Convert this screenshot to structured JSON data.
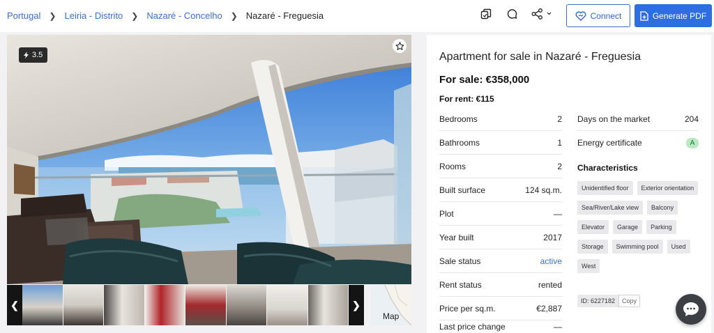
{
  "breadcrumbs": [
    "Portugal",
    "Leiria - Distrito",
    "Nazaré - Concelho"
  ],
  "breadcrumb_current": "Nazaré - Freguesia",
  "toolbar": {
    "connect_label": "Connect",
    "pdf_label": "Generate PDF"
  },
  "photo": {
    "score": "3.5"
  },
  "thumbnails": {
    "map_label": "Map"
  },
  "listing": {
    "title": "Apartment for sale in Nazaré - Freguesia",
    "sale": "For sale: €358,000",
    "rent": "For rent: €115",
    "details_left": [
      {
        "label": "Bedrooms",
        "value": "2"
      },
      {
        "label": "Bathrooms",
        "value": "1"
      },
      {
        "label": "Rooms",
        "value": "2"
      },
      {
        "label": "Built surface",
        "value": "124 sq.m."
      },
      {
        "label": "Plot",
        "value": "—"
      },
      {
        "label": "Year built",
        "value": "2017"
      },
      {
        "label": "Sale status",
        "value": "active"
      },
      {
        "label": "Rent status",
        "value": "rented"
      },
      {
        "label": "Price per sq.m.",
        "value": "€2,887"
      },
      {
        "label": "Last price change",
        "value": "—"
      }
    ],
    "details_right": [
      {
        "label": "Days on the market",
        "value": "204"
      },
      {
        "label": "Energy certificate",
        "value": "A"
      }
    ],
    "characteristics_title": "Characteristics",
    "characteristics": [
      "Unidentified floor",
      "Exterior orientation",
      "Sea/River/Lake view",
      "Balcony",
      "Elevator",
      "Garage",
      "Parking",
      "Storage",
      "Swimming pool",
      "Used",
      "West"
    ],
    "id_label": "ID: 6227182",
    "copy_label": "Copy"
  },
  "colors": {
    "accent": "#2f6ee0",
    "link": "#3a6fc4",
    "energy_badge": "#b9e8c3"
  }
}
